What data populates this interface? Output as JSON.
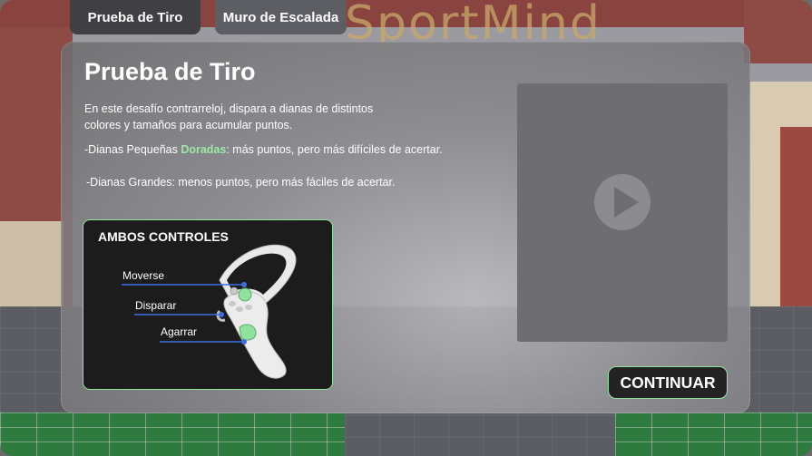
{
  "tabs": [
    {
      "label": "Prueba de Tiro",
      "active": true
    },
    {
      "label": "Muro de Escalada",
      "active": false
    }
  ],
  "background": {
    "banner_text": "SportMind"
  },
  "panel": {
    "title": "Prueba de Tiro",
    "description": "En este desafío contrarreloj, dispara a dianas de distintos colores y tamaños para acumular puntos.",
    "small_targets_prefix": "-Dianas Pequeñas ",
    "small_targets_highlight": "Doradas",
    "small_targets_suffix": ": más puntos, pero más difíciles de acertar.",
    "large_targets": "-Dianas Grandes: menos puntos, pero más fáciles de acertar.",
    "video": {
      "icon": "play-icon"
    },
    "controls": {
      "title": "AMBOS CONTROLES",
      "move_label": "Moverse",
      "shoot_label": "Disparar",
      "grab_label": "Agarrar"
    },
    "continue_label": "CONTINUAR"
  },
  "colors": {
    "accent": "#8fe39e",
    "highlight_text": "#9be8a6",
    "tab_active": "#3f3f44",
    "tab_inactive": "#5d5d64",
    "marker_blue": "#3c6ee0"
  }
}
